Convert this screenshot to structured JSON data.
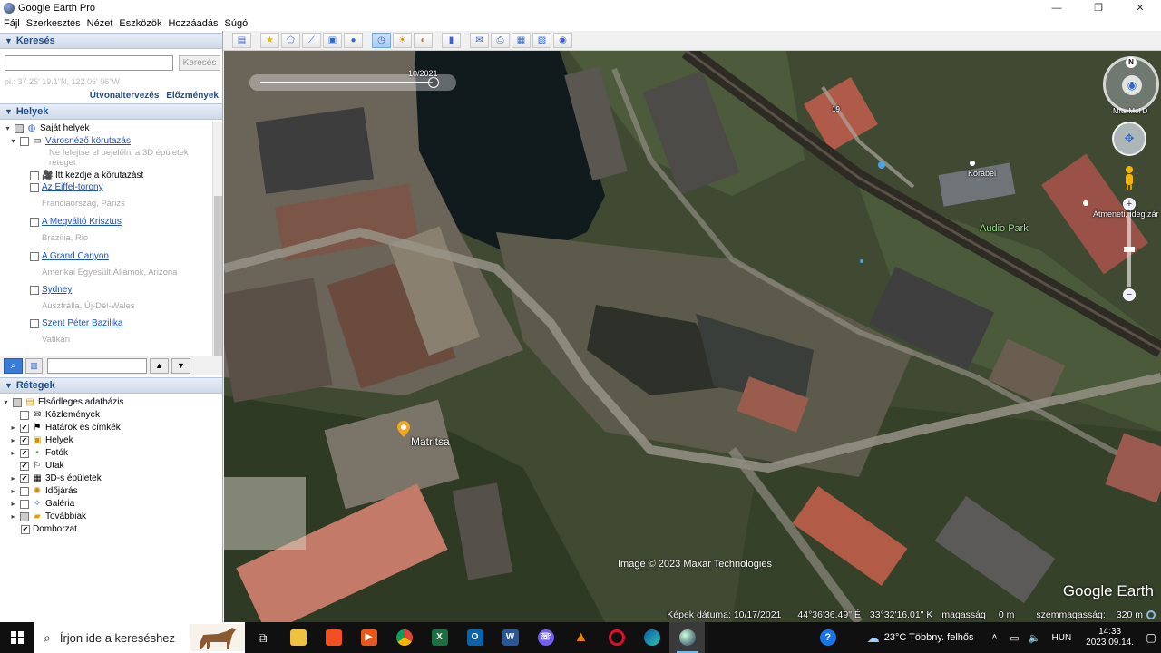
{
  "window": {
    "title": "Google Earth Pro",
    "minimize": "—",
    "maximize": "❐",
    "close": "✕"
  },
  "menu": [
    "Fájl",
    "Szerkesztés",
    "Nézet",
    "Eszközök",
    "Hozzáadás",
    "Súgó"
  ],
  "search": {
    "header": "Keresés",
    "input_value": "",
    "button_label": "Keresés",
    "coords_hint": "pl.: 37.25' 19.1\"N, 122.05' 06\"W",
    "route_link": "Útvonaltervezés",
    "history_link": "Előzmények"
  },
  "places": {
    "header": "Helyek",
    "root": "Saját helyek",
    "tour": {
      "label": "Városnéző körutazás",
      "desc1": "Ne felejtse el bejelölni a 3D épületek",
      "desc2": "réteget"
    },
    "tour_start": "Itt kezdje a körutazást",
    "items": [
      {
        "label": "Az Eiffel-torony",
        "desc": "Franciaország, Párizs"
      },
      {
        "label": "A Megváltó Krisztus",
        "desc": "Brazília, Rio"
      },
      {
        "label": "A Grand Canyon",
        "desc": "Amerikai Egyesült Államok, Arizona"
      },
      {
        "label": "Sydney",
        "desc": "Ausztrália, Új-Dél-Wales"
      },
      {
        "label": "Szent Péter Bazilika",
        "desc": "Vatikán"
      }
    ]
  },
  "layers": {
    "header": "Rétegek",
    "root": "Elsődleges adatbázis",
    "items": [
      {
        "label": "Közlemények",
        "checked": false,
        "expandable": false
      },
      {
        "label": "Határok és címkék",
        "checked": true,
        "expandable": true
      },
      {
        "label": "Helyek",
        "checked": true,
        "expandable": true
      },
      {
        "label": "Fotók",
        "checked": true,
        "expandable": true
      },
      {
        "label": "Utak",
        "checked": true,
        "expandable": false
      },
      {
        "label": "3D-s épületek",
        "checked": true,
        "expandable": true
      },
      {
        "label": "Időjárás",
        "checked": false,
        "expandable": true
      },
      {
        "label": "Galéria",
        "checked": false,
        "expandable": true
      },
      {
        "label": "Továbbiak",
        "checked": false,
        "expandable": true
      }
    ],
    "terrain": "Domborzat"
  },
  "map": {
    "time_label": "10/2021",
    "labels": {
      "matritsa": "Matritsa",
      "korabel": "Korabel",
      "audio_park": "Audio Park",
      "atmeneti": "Átmeneti, ideg.zár",
      "mfts": "Mfts Mol D",
      "num": "19"
    },
    "credit": "Image © 2023 Maxar Technologies",
    "watermark": "Google Earth",
    "status": {
      "date": "Képek dátuma: 10/17/2021",
      "lat": "44°36'36.49\" É",
      "lon": "33°32'16.01\" K",
      "elev_label": "magasság",
      "elev_value": "0 m",
      "eye_label": "szemmagasság:",
      "eye_value": "320 m"
    }
  },
  "taskbar": {
    "search_placeholder": "Írjon ide a kereséshez",
    "weather": "23°C  Többny. felhős",
    "lang": "HUN",
    "time": "14:33",
    "date": "2023.09.14."
  }
}
